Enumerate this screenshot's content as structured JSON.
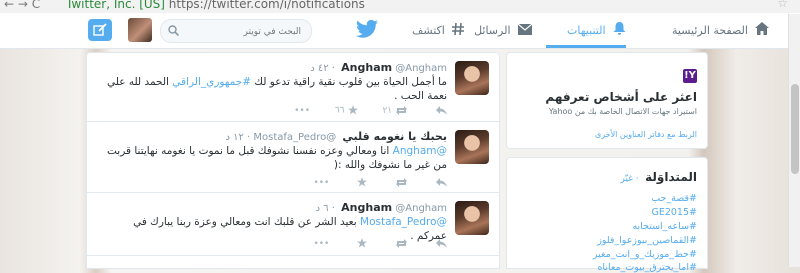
{
  "browser": {
    "url_secure": "Twitter, Inc. [US]",
    "url_rest": " https://twitter.com/i/notifications"
  },
  "nav": {
    "home": "الصفحة الرئيسية",
    "notifications": "التنبيهات",
    "messages": "الرسائل",
    "discover": "اكتشف",
    "search_placeholder": "البحث في تويتر"
  },
  "tweets": [
    {
      "name": "Angham",
      "handle": "@Angham",
      "time": "٤٢ د",
      "text": "ما أجمل الحياة بين قلوب نقية راقية  تدعو لك ",
      "link": "#جمهوري_الراقي",
      "text_after": " الحمد لله علي نعمة الحب .",
      "retweets": "٢١",
      "favorites": "٦٦"
    },
    {
      "name": "بحبك يا نغومه قلبي",
      "handle": "@Mostafa_Pedro",
      "time": "١٢ د",
      "reply_to": "@Angham",
      "text": " انا ومعالي وعزه نفسنا نشوفك قبل ما نموت يا نغومه نهايتنا قربت من غير ما نشوفك والله :(",
      "retweets": "",
      "favorites": ""
    },
    {
      "name": "Angham",
      "handle": "@Angham",
      "time": "٦ د",
      "reply_to": "@Mostafa_Pedro",
      "text": " بعيد الشر عن قلبك انت ومعالي وعزة  ربنا يبارك في عمركم .",
      "retweets": "",
      "favorites": ""
    }
  ],
  "who_to_follow": {
    "badge": "Y!",
    "title": "اعثر على أشخاص تعرفهم",
    "subtitle": "استيراد جهات الاتصال الخاصة بك من Yahoo",
    "footer": "الربط مع دفاتر العناوين الأخرى"
  },
  "trends": {
    "title": "المتداوَلة",
    "change": "· غيّر",
    "items": [
      "#قصة_حب",
      "#GE2015",
      "#ساعه_استجابه",
      "#القماصين_بيوزعوا_فلوز",
      "#حط_موزيك_و_انت_مغير",
      "#اما_يحترق_بيوت_معاناه"
    ]
  },
  "colors": {
    "accent": "#55acee",
    "text": "#292f33",
    "muted": "#8899a6"
  }
}
